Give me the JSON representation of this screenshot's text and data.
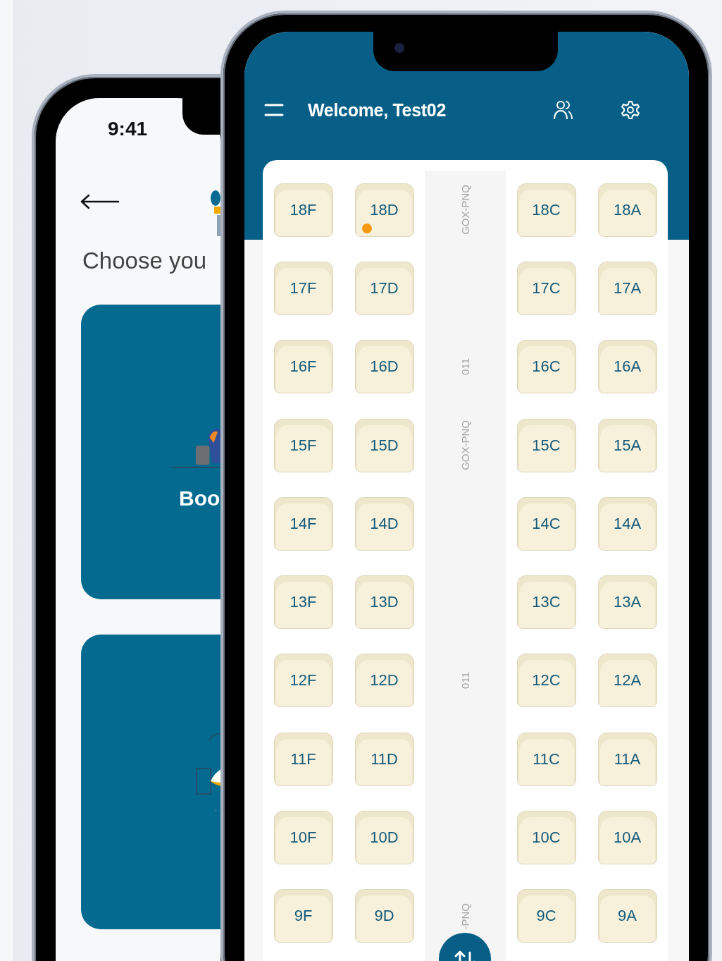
{
  "left_phone": {
    "status_bar": {
      "time": "9:41"
    },
    "heading": "Choose you",
    "cards": [
      {
        "kind": "traveler",
        "label": "Boo"
      },
      {
        "kind": "airplane"
      }
    ]
  },
  "right_phone": {
    "title": "Welcome, Test02",
    "rows": [
      {
        "aisle_label": "GOX-PNQ",
        "seats": [
          {
            "label": "18F",
            "indicator": false
          },
          {
            "label": "18D",
            "indicator": true
          },
          {
            "label": "18C",
            "indicator": false
          },
          {
            "label": "18A",
            "indicator": false
          }
        ]
      },
      {
        "seats": [
          {
            "label": "17F",
            "indicator": false
          },
          {
            "label": "17D",
            "indicator": false
          },
          {
            "label": "17C",
            "indicator": false
          },
          {
            "label": "17A",
            "indicator": false
          }
        ]
      },
      {
        "aisle_label": "011",
        "seats": [
          {
            "label": "16F",
            "indicator": false
          },
          {
            "label": "16D",
            "indicator": false
          },
          {
            "label": "16C",
            "indicator": false
          },
          {
            "label": "16A",
            "indicator": false
          }
        ]
      },
      {
        "aisle_label": "GOX-PNQ",
        "seats": [
          {
            "label": "15F",
            "indicator": false
          },
          {
            "label": "15D",
            "indicator": false
          },
          {
            "label": "15C",
            "indicator": false
          },
          {
            "label": "15A",
            "indicator": false
          }
        ]
      },
      {
        "seats": [
          {
            "label": "14F",
            "indicator": false
          },
          {
            "label": "14D",
            "indicator": false
          },
          {
            "label": "14C",
            "indicator": false
          },
          {
            "label": "14A",
            "indicator": false
          }
        ]
      },
      {
        "seats": [
          {
            "label": "13F",
            "indicator": false
          },
          {
            "label": "13D",
            "indicator": false
          },
          {
            "label": "13C",
            "indicator": false
          },
          {
            "label": "13A",
            "indicator": false
          }
        ]
      },
      {
        "aisle_label": "011",
        "seats": [
          {
            "label": "12F",
            "indicator": false
          },
          {
            "label": "12D",
            "indicator": false
          },
          {
            "label": "12C",
            "indicator": false
          },
          {
            "label": "12A",
            "indicator": false
          }
        ]
      },
      {
        "seats": [
          {
            "label": "11F",
            "indicator": false
          },
          {
            "label": "11D",
            "indicator": false
          },
          {
            "label": "11C",
            "indicator": false
          },
          {
            "label": "11A",
            "indicator": false
          }
        ]
      },
      {
        "seats": [
          {
            "label": "10F",
            "indicator": false
          },
          {
            "label": "10D",
            "indicator": false
          },
          {
            "label": "10C",
            "indicator": false
          },
          {
            "label": "10A",
            "indicator": false
          }
        ]
      },
      {
        "aisle_label": "-PNQ",
        "seats": [
          {
            "label": "9F",
            "indicator": false
          },
          {
            "label": "9D",
            "indicator": false
          },
          {
            "label": "9C",
            "indicator": false
          },
          {
            "label": "9A",
            "indicator": false
          }
        ]
      }
    ]
  }
}
